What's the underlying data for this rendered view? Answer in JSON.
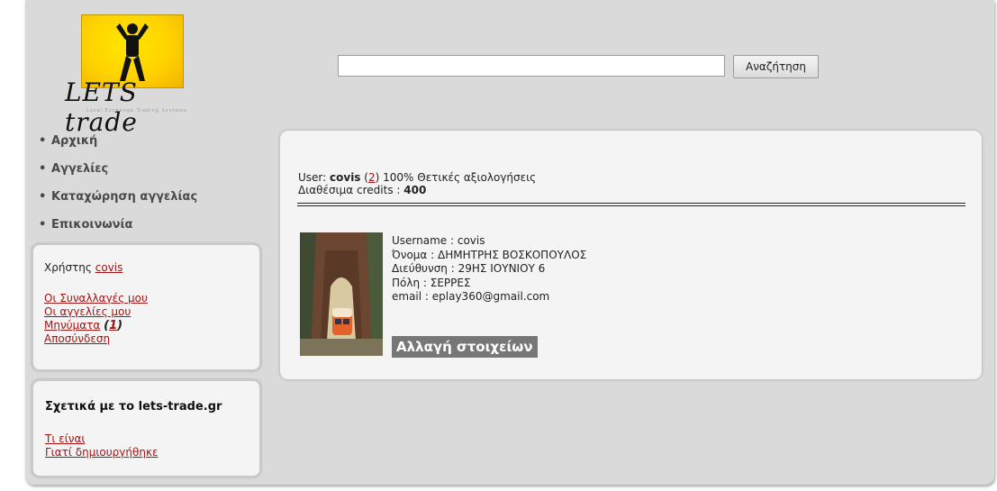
{
  "logo": {
    "text": "LETS trade",
    "tagline": "Local Exchange Trading Systems"
  },
  "search": {
    "placeholder": "",
    "value": "",
    "button_label": "Αναζήτηση"
  },
  "nav": {
    "bullet": "•",
    "items": [
      "Αρχική",
      "Αγγελίες",
      "Καταχώρηση αγγελίας",
      "Επικοινωνία"
    ]
  },
  "user_box": {
    "user_prefix": "Χρήστης",
    "username": "covis",
    "links": {
      "transactions": "Οι Συναλλαγές μου",
      "my_ads": "Οι αγγελίες μου",
      "messages": "Μηνύματα",
      "logout": "Αποσύνδεση"
    },
    "messages_open": "(",
    "messages_count": "1",
    "messages_close": ")"
  },
  "about_box": {
    "title": "Σχετικά με το lets-trade.gr",
    "links": {
      "what_is": "Τι είναι",
      "why_created": "Γιατί δημιουργήθηκε"
    }
  },
  "profile": {
    "user_label": "User:",
    "username": "covis",
    "ratings_open": "(",
    "ratings_count": "2",
    "ratings_close": ")",
    "ratings_text": "100% Θετικές αξιολογήσεις",
    "credits_label": "Διαθέσιμα credits :",
    "credits_value": "400",
    "details": [
      "Username : covis",
      "Όνομα : ΔΗΜΗΤΡΗΣ ΒΟΣΚΟΠΟΥΛΟΣ",
      "Διεύθυνση : 29ΗΣ ΙΟΥΝΙΟΥ 6",
      "Πόλη : ΣΕΡΡΕΣ",
      "email : eplay360@gmail.com"
    ],
    "edit_button_label": "Αλλαγή στοιχείων"
  },
  "colors": {
    "frame": "#dadada",
    "panel": "#f4f4f4",
    "link": "#a31515",
    "edit_button": "#777777"
  }
}
